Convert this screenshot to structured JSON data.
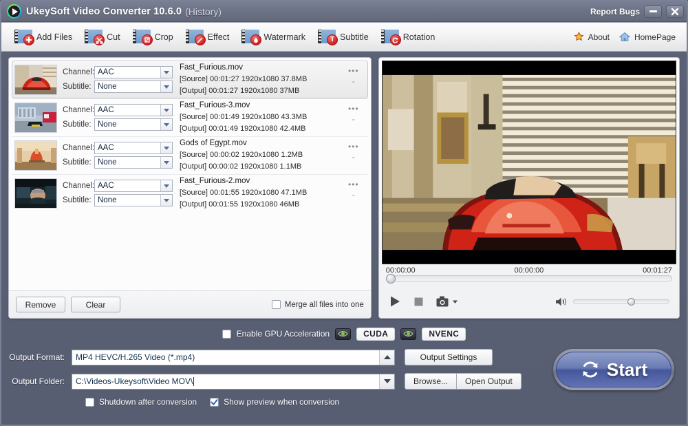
{
  "window": {
    "title": "UkeySoft Video Converter 10.6.0",
    "history_label": "(History)",
    "report_bugs": "Report Bugs",
    "minimize_icon": "minimize-icon",
    "close_icon": "close-icon",
    "logo_icon": "play-logo-icon"
  },
  "toolbar": {
    "items": [
      {
        "label": "Add Files",
        "icon": "film-plus-icon",
        "glyph": "+"
      },
      {
        "label": "Cut",
        "icon": "film-scissors-icon",
        "glyph": "✂"
      },
      {
        "label": "Crop",
        "icon": "film-crop-icon",
        "glyph": "◰"
      },
      {
        "label": "Effect",
        "icon": "film-wand-icon",
        "glyph": "✦"
      },
      {
        "label": "Watermark",
        "icon": "film-drop-icon",
        "glyph": "●"
      },
      {
        "label": "Subtitle",
        "icon": "film-text-icon",
        "glyph": "T"
      },
      {
        "label": "Rotation",
        "icon": "film-rotate-icon",
        "glyph": "↻"
      }
    ],
    "links": [
      {
        "label": "About",
        "icon": "star-icon"
      },
      {
        "label": "HomePage",
        "icon": "home-icon"
      }
    ]
  },
  "file_list": {
    "channel_label": "Channel:",
    "subtitle_label": "Subtitle:",
    "source_tag": "[Source]",
    "output_tag": "[Output]",
    "more_glyph": "•••",
    "dash_glyph": "-",
    "rows": [
      {
        "selected": true,
        "name": "Fast_Furious.mov",
        "channel": "AAC",
        "subtitle": "None",
        "source": "[Source]  00:01:27  1920x1080  37.8MB",
        "output": "[Output]  00:01:27  1920x1080  37MB",
        "thumb": "red-sports-car"
      },
      {
        "selected": false,
        "name": "Fast_Furious-3.mov",
        "channel": "AAC",
        "subtitle": "None",
        "source": "[Source]  00:01:49  1920x1080  43.3MB",
        "output": "[Output]  00:01:49  1920x1080  42.4MB",
        "thumb": "street-red-bus"
      },
      {
        "selected": false,
        "name": "Gods of Egypt.mov",
        "channel": "AAC",
        "subtitle": "None",
        "source": "[Source]  00:00:02  1920x1080  1.2MB",
        "output": "[Output]  00:00:02  1920x1080  1.1MB",
        "thumb": "egypt-desert"
      },
      {
        "selected": false,
        "name": "Fast_Furious-2.mov",
        "channel": "AAC",
        "subtitle": "None",
        "source": "[Source]  00:01:55  1920x1080  47.1MB",
        "output": "[Output]  00:01:55  1920x1080  46MB",
        "thumb": "man-in-car"
      }
    ],
    "footer": {
      "remove": "Remove",
      "clear": "Clear",
      "merge_label": "Merge all files into one",
      "merge_checked": false
    }
  },
  "player": {
    "time_start": "00:00:00",
    "time_current": "00:00:00",
    "time_total": "00:01:27",
    "play_icon": "play-icon",
    "stop_icon": "stop-icon",
    "snapshot_icon": "camera-icon",
    "snapshot_caret_icon": "caret-down-icon",
    "volume_icon": "volume-icon",
    "seek_position_pct": 0,
    "volume_pct": 56
  },
  "gpu": {
    "label": "Enable GPU Acceleration",
    "checked": false,
    "cuda": "CUDA",
    "nvenc": "NVENC",
    "nv_icon": "nvidia-eye-icon"
  },
  "output": {
    "format_label": "Output Format:",
    "format_value": "MP4 HEVC/H.265 Video (*.mp4)",
    "format_caret_icon": "caret-up-icon",
    "folder_label": "Output Folder:",
    "folder_value": "C:\\Videos-Ukeysoft\\Video MOV\\",
    "folder_caret_icon": "caret-down-icon",
    "settings_button": "Output Settings",
    "browse_button": "Browse...",
    "open_output_button": "Open Output"
  },
  "start": {
    "label": "Start",
    "icon": "refresh-icon"
  },
  "bottom_options": {
    "shutdown_label": "Shutdown after conversion",
    "shutdown_checked": false,
    "preview_label": "Show preview when conversion",
    "preview_checked": true
  },
  "colors": {
    "window_bg": "#5b6073",
    "accent_blue": "#45579c",
    "badge_red": "#d01f1f",
    "panel_bg": "#fbfbfb"
  }
}
